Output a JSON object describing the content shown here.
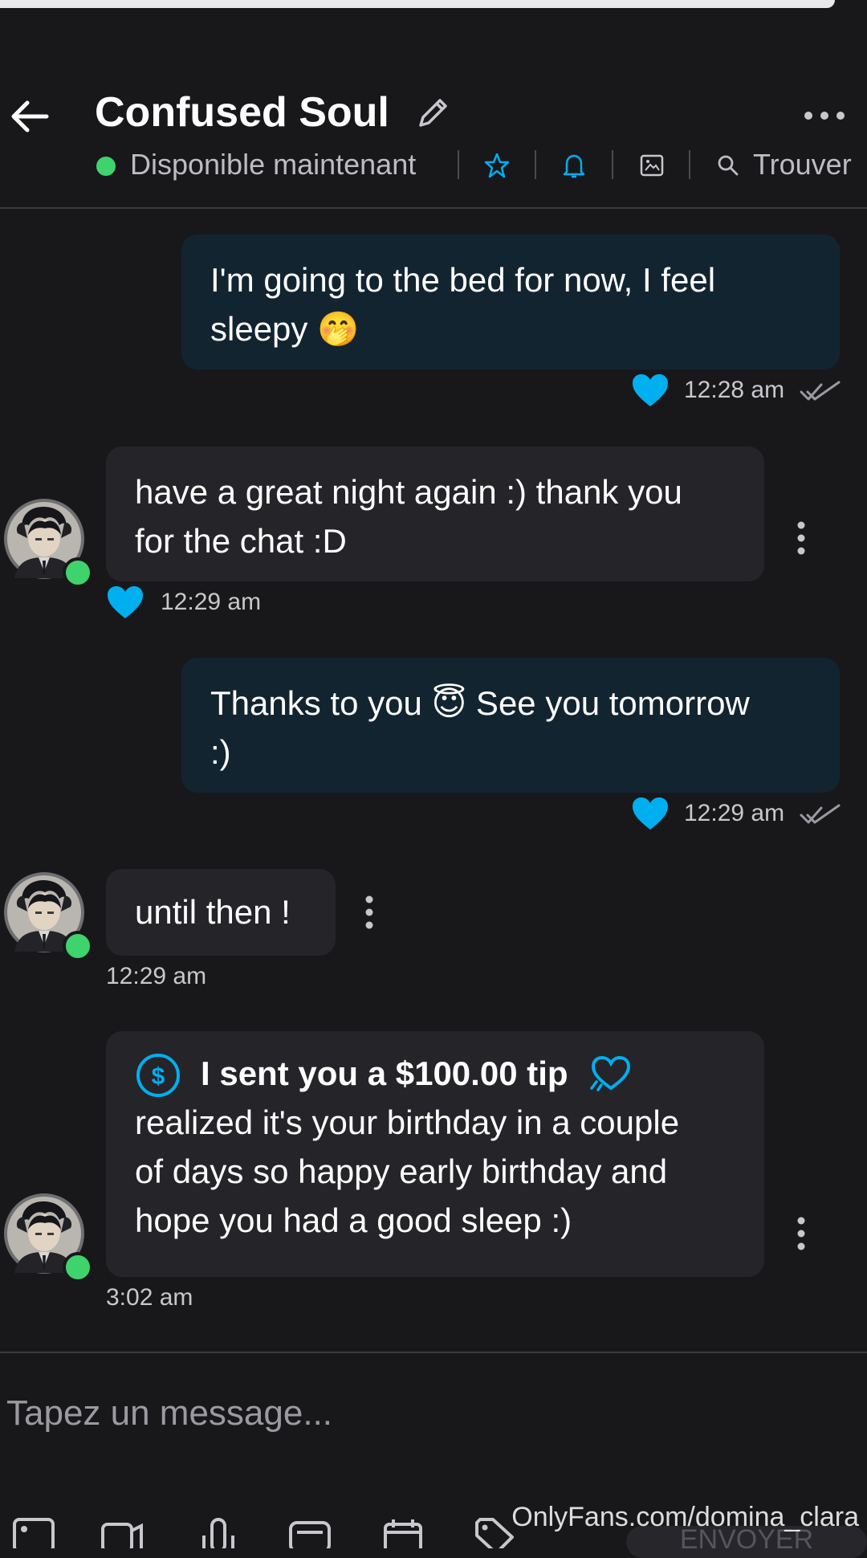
{
  "header": {
    "title": "Confused Soul",
    "status": "Disponible maintenant",
    "find_label": "Trouver"
  },
  "messages": [
    {
      "direction": "outgoing",
      "text_lines": [
        "I'm going to the bed for now, I feel",
        "sleepy 🤭"
      ],
      "time": "12:28 am",
      "liked": true
    },
    {
      "direction": "incoming",
      "text_lines": [
        "have a great night again :) thank you",
        "for the chat :D"
      ],
      "time": "12:29 am",
      "liked": true
    },
    {
      "direction": "outgoing",
      "text_lines": [
        "Thanks to you 😇 See you tomorrow",
        ":)"
      ],
      "time": "12:29 am",
      "liked": true
    },
    {
      "direction": "incoming",
      "text_lines": [
        "until then !"
      ],
      "time": "12:29 am",
      "liked": false
    },
    {
      "direction": "incoming",
      "tip": "I sent you a $100.00 tip",
      "text_lines": [
        "realized it's your birthday in a couple",
        "of days so happy early birthday and",
        "hope you had a good sleep :)"
      ],
      "time": "3:02 am",
      "liked": false
    }
  ],
  "composer": {
    "placeholder": "Tapez un message..."
  },
  "send_label": "ENVOYER",
  "watermark": "OnlyFans.com/domina_clara",
  "colors": {
    "accent": "#00aff0",
    "online": "#3ed36c",
    "outgoing_bubble": "#132431",
    "incoming_bubble": "#252529",
    "background": "#18181b"
  },
  "icons": [
    "back-arrow-icon",
    "pencil-icon",
    "more-horizontal-icon",
    "star-icon",
    "bell-icon",
    "image-icon",
    "search-icon",
    "heart-icon",
    "double-check-icon",
    "dollar-icon",
    "kebab-icon",
    "attach-image-icon",
    "video-icon",
    "microphone-icon",
    "vault-icon",
    "calendar-icon",
    "price-tag-icon"
  ]
}
